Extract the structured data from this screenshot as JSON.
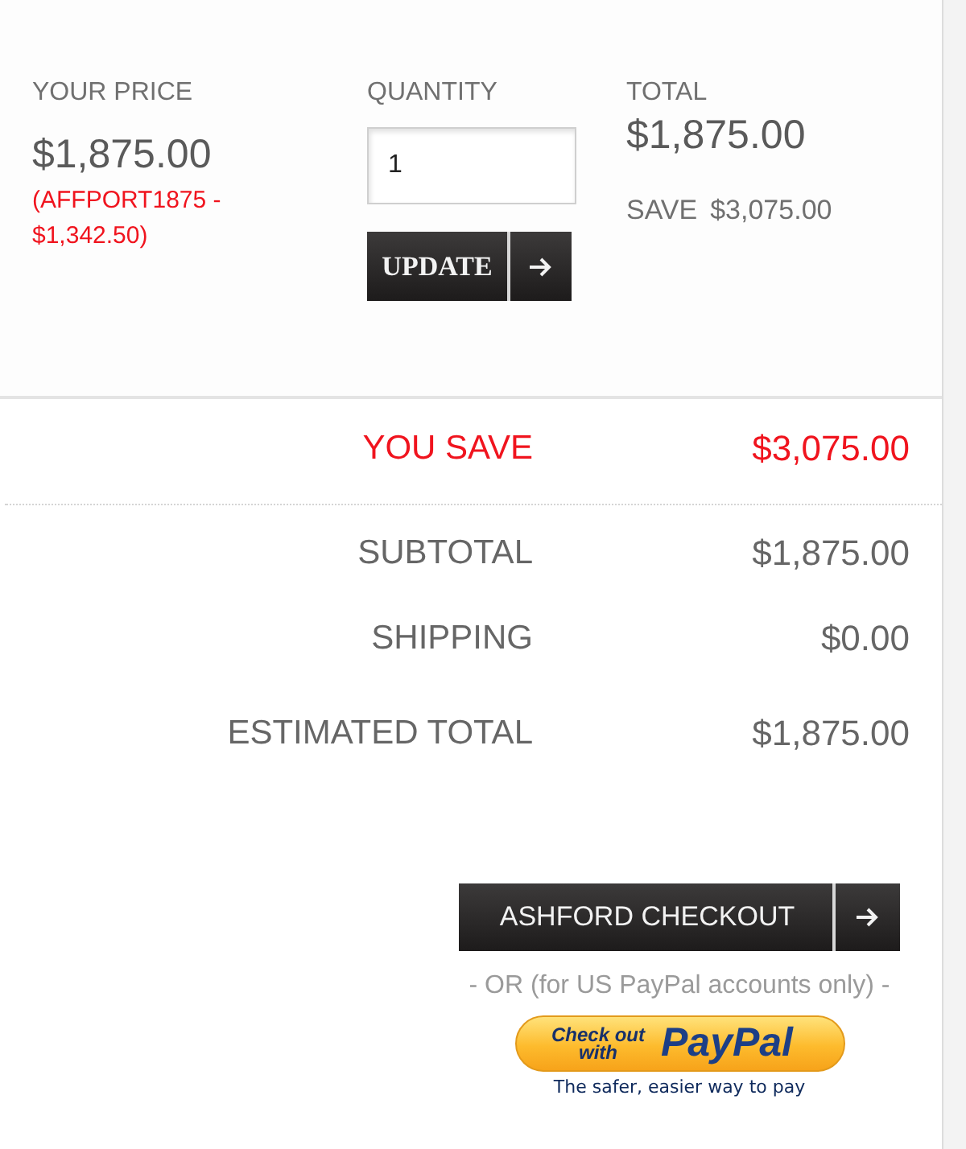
{
  "price_panel": {
    "your_price": {
      "label": "YOUR PRICE",
      "amount": "$1,875.00",
      "promo": "(AFFPORT1875 - $1,342.50)"
    },
    "quantity": {
      "label": "QUANTITY",
      "value": "1"
    },
    "update_button": {
      "label": "UPDATE"
    },
    "total": {
      "label": "TOTAL",
      "amount": "$1,875.00",
      "save_label": "SAVE",
      "save_amount": "$3,075.00"
    }
  },
  "summary": [
    {
      "kind": "savings",
      "label": "YOU SAVE",
      "value": "$3,075.00"
    },
    {
      "kind": "line",
      "label": "SUBTOTAL",
      "value": "$1,875.00"
    },
    {
      "kind": "line",
      "label": "SHIPPING",
      "value": "$0.00"
    },
    {
      "kind": "line",
      "label": "ESTIMATED TOTAL",
      "value": "$1,875.00"
    }
  ],
  "checkout": {
    "button": "ASHFORD CHECKOUT",
    "alternative": "- OR (for US PayPal accounts only) -",
    "paypal_button": {
      "caption": "Check out with",
      "brand": "PayPal"
    },
    "paypal_tagline": "The safer, easier way to pay"
  }
}
